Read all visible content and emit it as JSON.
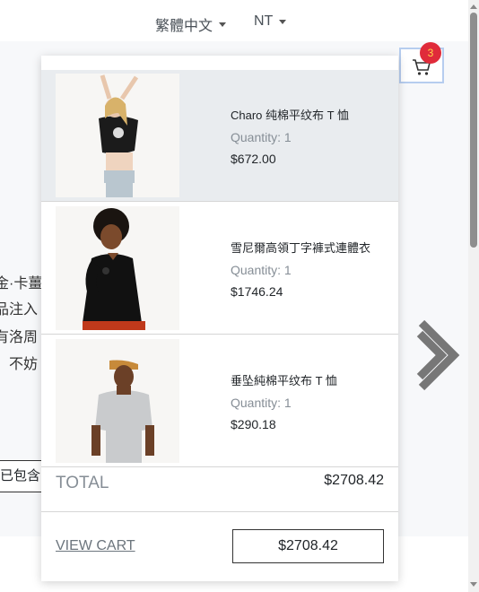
{
  "topbar": {
    "language": "繁體中文",
    "currency": "NT"
  },
  "background": {
    "text_lines": [
      "金·卡薑",
      "品注入",
      "有洛周",
      "。不妨"
    ],
    "button_fragment": "已包含"
  },
  "cart": {
    "badge_count": "3",
    "items": [
      {
        "name": "Charo 纯棉平纹布 T 恤",
        "quantity": "Quantity: 1",
        "price": "$672.00"
      },
      {
        "name": "雪尼爾高領丁字褲式連體衣",
        "quantity": "Quantity: 1",
        "price": "$1746.24"
      },
      {
        "name": "垂坠純棉平纹布 T 恤",
        "quantity": "Quantity: 1",
        "price": "$290.18"
      }
    ],
    "total_label": "TOTAL",
    "total_value": "$2708.42",
    "view_cart_label": "VIEW CART",
    "checkout_label": "$2708.42"
  },
  "colors": {
    "badge": "#e02b3a",
    "badge_text": "#ffd54a",
    "highlight_row": "#e9ecef"
  }
}
